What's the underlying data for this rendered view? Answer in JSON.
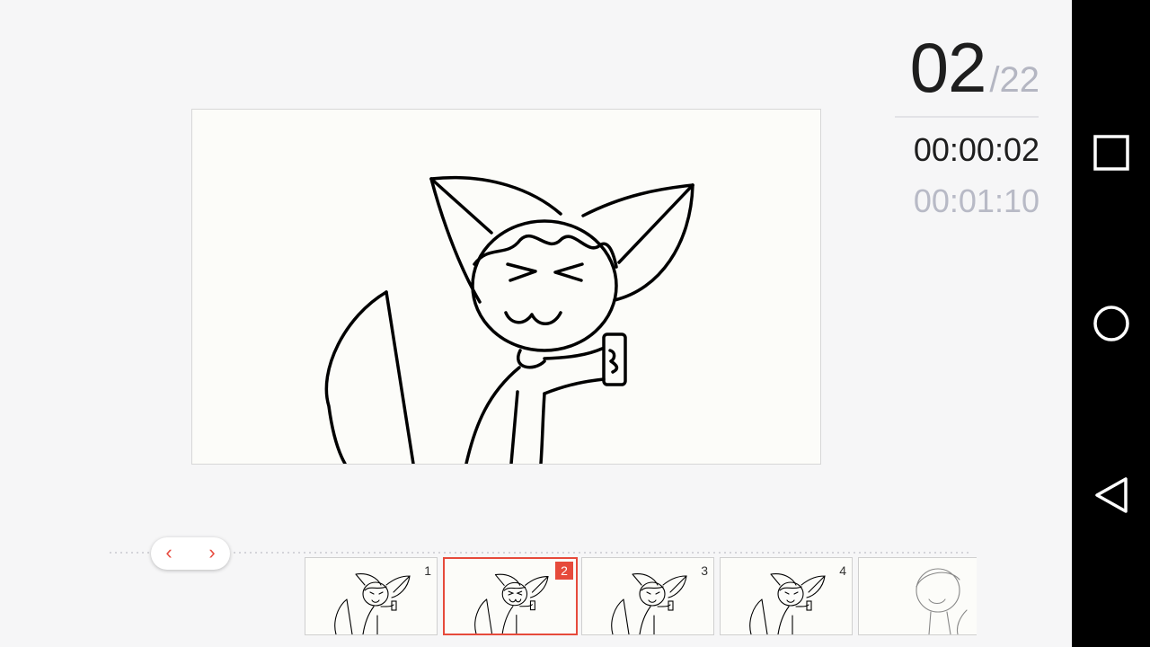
{
  "counter": {
    "current": "02",
    "separator": "/",
    "total": "22"
  },
  "timecode": {
    "current": "00:00:02",
    "total": "00:01:10"
  },
  "timeline": {
    "prev_label": "‹",
    "next_label": "›",
    "frames": [
      {
        "number": "1",
        "selected": false
      },
      {
        "number": "2",
        "selected": true
      },
      {
        "number": "3",
        "selected": false
      },
      {
        "number": "4",
        "selected": false
      },
      {
        "number": "",
        "selected": false
      }
    ]
  },
  "navbar": {
    "recents_icon": "square-icon",
    "home_icon": "circle-icon",
    "back_icon": "triangle-back-icon"
  },
  "colors": {
    "accent": "#e64a3b",
    "text_primary": "#1e1e1e",
    "text_muted": "#b8bac6",
    "background": "#f6f6f7",
    "canvas": "#fcfcf9"
  }
}
